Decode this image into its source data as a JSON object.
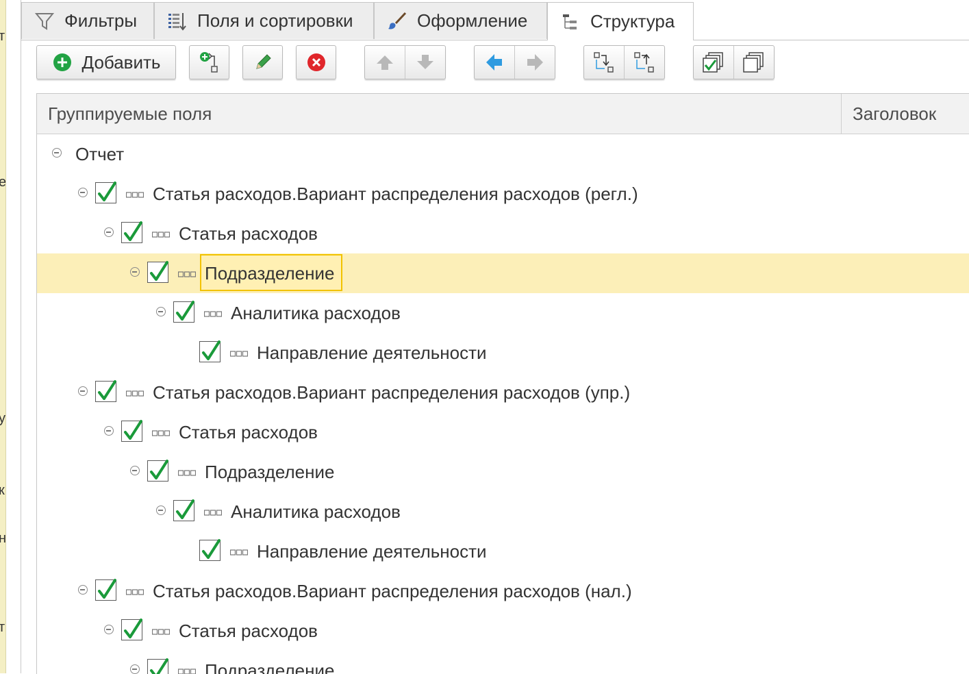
{
  "tabs": [
    {
      "label": "Фильтры",
      "icon": "filter-icon"
    },
    {
      "label": "Поля и сортировки",
      "icon": "fields-sort-icon"
    },
    {
      "label": "Оформление",
      "icon": "brush-icon"
    },
    {
      "label": "Структура",
      "icon": "structure-tree-icon",
      "active": true
    }
  ],
  "toolbar": {
    "add_label": "Добавить",
    "icons": [
      "plus-circle-icon",
      "add-group-icon",
      "pencil-icon",
      "delete-icon",
      "arrow-up-icon",
      "arrow-down-icon",
      "arrow-left-icon",
      "arrow-right-icon",
      "move-to-parent-icon",
      "move-to-child-icon",
      "check-all-icon",
      "uncheck-all-icon"
    ]
  },
  "columns": {
    "grouping_fields": "Группируемые поля",
    "title": "Заголовок"
  },
  "rows": [
    {
      "label": "Отчет",
      "level": 0,
      "toggle": true,
      "checkbox": false
    },
    {
      "label": "Статья расходов.Вариант распределения расходов (регл.)",
      "level": 1,
      "toggle": true,
      "checkbox": true,
      "checked": true
    },
    {
      "label": "Статья расходов",
      "level": 2,
      "toggle": true,
      "checkbox": true,
      "checked": true
    },
    {
      "label": "Подразделение",
      "level": 3,
      "toggle": true,
      "checkbox": true,
      "checked": true,
      "selected": true
    },
    {
      "label": "Аналитика расходов",
      "level": 4,
      "toggle": true,
      "checkbox": true,
      "checked": true
    },
    {
      "label": "Направление деятельности",
      "level": 5,
      "toggle": false,
      "checkbox": true,
      "checked": true
    },
    {
      "label": "Статья расходов.Вариант распределения расходов (упр.)",
      "level": 1,
      "toggle": true,
      "checkbox": true,
      "checked": true
    },
    {
      "label": "Статья расходов",
      "level": 2,
      "toggle": true,
      "checkbox": true,
      "checked": true
    },
    {
      "label": "Подразделение",
      "level": 3,
      "toggle": true,
      "checkbox": true,
      "checked": true
    },
    {
      "label": "Аналитика расходов",
      "level": 4,
      "toggle": true,
      "checkbox": true,
      "checked": true
    },
    {
      "label": "Направление деятельности",
      "level": 5,
      "toggle": false,
      "checkbox": true,
      "checked": true
    },
    {
      "label": "Статья расходов.Вариант распределения расходов (нал.)",
      "level": 1,
      "toggle": true,
      "checkbox": true,
      "checked": true
    },
    {
      "label": "Статья расходов",
      "level": 2,
      "toggle": true,
      "checkbox": true,
      "checked": true
    },
    {
      "label": "Подразделение",
      "level": 3,
      "toggle": true,
      "checkbox": true,
      "checked": true
    }
  ],
  "left_strip_glyphs": [
    "т",
    "е",
    "у",
    "к",
    "н",
    "т"
  ],
  "colors": {
    "selected_row": "#fcefb8",
    "focus_border": "#f2c200",
    "check_green": "#1a9a3a",
    "delete_red": "#e0262b",
    "arrow_blue": "#2f9be0"
  }
}
